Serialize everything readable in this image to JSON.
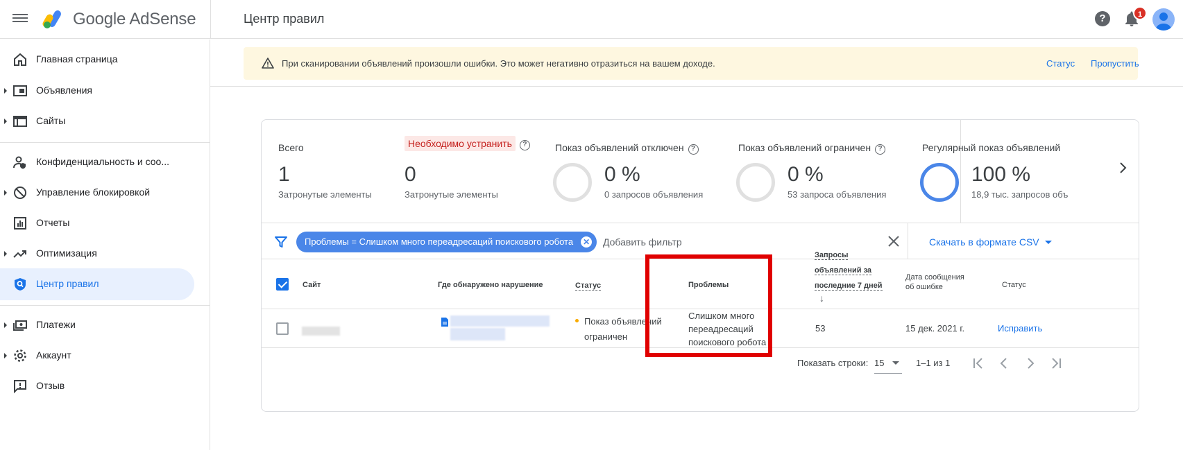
{
  "topbar": {
    "brand": "Google AdSense",
    "page_title": "Центр правил",
    "help_glyph": "?",
    "notification_count": "1",
    "icons": [
      "menu-icon",
      "adsense-logo",
      "help-icon",
      "bell-icon",
      "avatar"
    ]
  },
  "sidebar": {
    "items": [
      {
        "label": "Главная страница",
        "icon": "home-icon",
        "expandable": false
      },
      {
        "label": "Объявления",
        "icon": "ads-icon",
        "expandable": true
      },
      {
        "label": "Сайты",
        "icon": "sites-icon",
        "expandable": true
      },
      {
        "label": "Конфиденциальность и соо...",
        "icon": "privacy-icon",
        "expandable": false
      },
      {
        "label": "Управление блокировкой",
        "icon": "block-icon",
        "expandable": true
      },
      {
        "label": "Отчеты",
        "icon": "reports-icon",
        "expandable": false
      },
      {
        "label": "Оптимизация",
        "icon": "trending-icon",
        "expandable": true
      },
      {
        "label": "Центр правил",
        "icon": "policy-shield-icon",
        "expandable": false,
        "active": true
      },
      {
        "label": "Платежи",
        "icon": "payments-icon",
        "expandable": true
      },
      {
        "label": "Аккаунт",
        "icon": "settings-icon",
        "expandable": true
      },
      {
        "label": "Отзыв",
        "icon": "feedback-icon",
        "expandable": false
      }
    ]
  },
  "banner": {
    "text": "При сканировании объявлений произошли ошибки. Это может негативно отразиться на вашем доходе.",
    "status_link": "Статус",
    "skip_link": "Пропустить"
  },
  "stats": {
    "total": {
      "label": "Всего",
      "value": "1",
      "sub": "Затронутые элементы"
    },
    "must_fix": {
      "label": "Необходимо устранить",
      "value": "0",
      "sub": "Затронутые элементы"
    },
    "disabled": {
      "label": "Показ объявлений отключен",
      "value": "0 %",
      "sub": "0 запросов объявления",
      "ring_percent": 0
    },
    "limited": {
      "label": "Показ объявлений ограничен",
      "value": "0 %",
      "sub": "53 запроса объявления",
      "ring_percent": 0
    },
    "regular": {
      "label": "Регулярный показ объявлений",
      "value": "100 %",
      "sub": "18,9 тыс. запросов объ",
      "ring_percent": 100
    }
  },
  "filter": {
    "chip": "Проблемы = Слишком много переадресаций поискового робота",
    "add_filter": "Добавить фильтр",
    "csv": "Скачать в формате CSV"
  },
  "table": {
    "headers": {
      "site": "Сайт",
      "where": "Где обнаружено нарушение",
      "status": "Статус",
      "problems": "Проблемы",
      "requests_l1": "Запросы",
      "requests_l2": "объявлений за",
      "requests_l3": "последние 7 дней",
      "sort_arrow": "↓",
      "date_l1": "Дата сообщения",
      "date_l2": "об ошибке",
      "action": "Статус"
    },
    "rows": [
      {
        "status_l1": "Показ объявлений",
        "status_l2": "ограничен",
        "problem_l1": "Слишком много",
        "problem_l2": "переадресаций",
        "problem_l3": "поискового робота",
        "requests": "53",
        "date": "15 дек. 2021 г.",
        "action": "Исправить"
      }
    ]
  },
  "pagination": {
    "rows_label": "Показать строки:",
    "rows_value": "15",
    "range": "1–1 из 1"
  },
  "colors": {
    "accent": "#1a73e8",
    "chip": "#4a86e8",
    "warning_bg": "#fef7e0",
    "highlight": "#e00000"
  }
}
